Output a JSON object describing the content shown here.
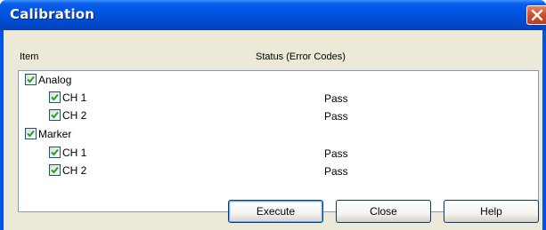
{
  "window": {
    "title": "Calibration"
  },
  "columns": {
    "item": "Item",
    "status": "Status (Error Codes)"
  },
  "rows": [
    {
      "label": "Analog",
      "checked": true,
      "level": 0,
      "status": ""
    },
    {
      "label": "CH 1",
      "checked": true,
      "level": 1,
      "status": "Pass"
    },
    {
      "label": "CH 2",
      "checked": true,
      "level": 1,
      "status": "Pass"
    },
    {
      "label": "Marker",
      "checked": true,
      "level": 0,
      "status": ""
    },
    {
      "label": "CH 1",
      "checked": true,
      "level": 1,
      "status": "Pass"
    },
    {
      "label": "CH 2",
      "checked": true,
      "level": 1,
      "status": "Pass"
    }
  ],
  "buttons": {
    "execute": "Execute",
    "close": "Close",
    "help": "Help"
  },
  "colors": {
    "titlebar": "#0054e3",
    "dialog_bg": "#ece9d8",
    "check": "#21a121",
    "close_btn": "#d4502f"
  }
}
